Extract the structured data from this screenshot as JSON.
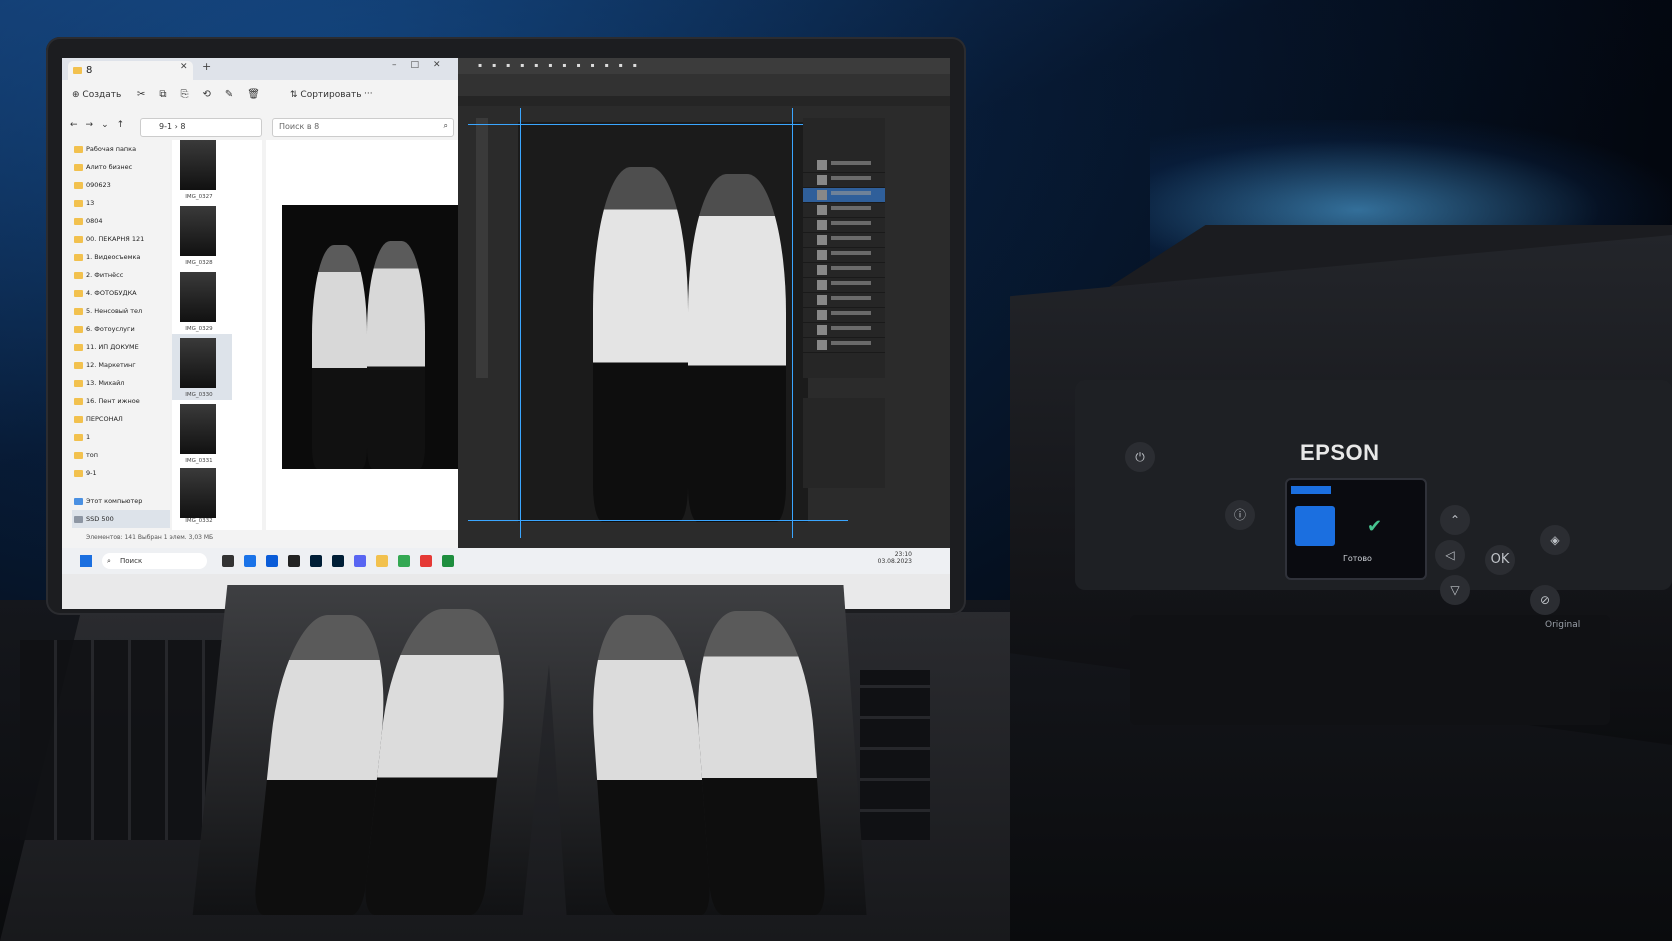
{
  "explorer": {
    "tab_title": "8",
    "toolbar": {
      "create": "Создать",
      "sort": "Сортировать",
      "more": "···"
    },
    "address": "9-1 › 8",
    "search_placeholder": "Поиск в 8",
    "nav_items": [
      "Рабочая папка",
      "Алито бизнес",
      "090623",
      "13",
      "0804",
      "00. ПЕКАРНЯ 121",
      "1. Видеосъемка",
      "2. Фитнёсс",
      "4. ФОТОБУДКА",
      "5. Ненсовый тел",
      "6. Фотоуслуги",
      "11. ИП ДОКУМЕ",
      "12. Маркетинг",
      "13. Михайл",
      "16. Пент ижное",
      "ПЕРСОНАЛ",
      "1",
      "топ",
      "9-1",
      "Этот компьютер",
      "SSD 500"
    ],
    "thumbnails": [
      "IMG_0327",
      "IMG_0328",
      "IMG_0329",
      "IMG_0330",
      "IMG_0331",
      "IMG_0332"
    ],
    "status": "Элементов: 141    Выбран 1 элем. 3,03 МБ"
  },
  "taskbar": {
    "search": "Поиск",
    "time": "23:10",
    "date": "03.08.2023"
  },
  "printer": {
    "brand": "EPSON",
    "lcd_label": "Готово",
    "ok_button": "OK",
    "badge": "Original"
  },
  "colors": {
    "accent_blue": "#1b6fe0",
    "guide_blue": "#3aa6ff",
    "check_green": "#46c48f"
  },
  "icons": [
    "power-icon",
    "up-arrow-icon",
    "down-arrow-icon",
    "left-arrow-icon",
    "home-icon",
    "stop-icon",
    "search-icon",
    "folder-icon"
  ]
}
